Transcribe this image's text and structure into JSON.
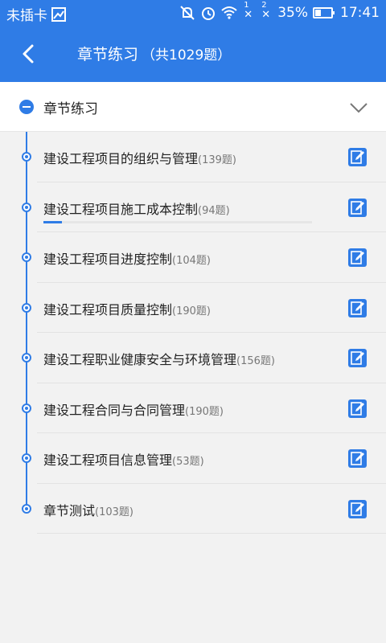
{
  "status_bar": {
    "carrier": "未插卡",
    "battery": "35%",
    "time": "17:41",
    "sim1": "1",
    "sim2": "2",
    "icons": [
      "image-icon",
      "mute-icon",
      "alarm-icon",
      "wifi-icon",
      "no-signal-icon",
      "no-signal-icon",
      "battery-icon"
    ]
  },
  "appbar": {
    "title": "章节练习",
    "subtitle": "（共1029题）"
  },
  "chapter": {
    "title": "章节练习"
  },
  "sections": [
    {
      "name": "建设工程项目的组织与管理",
      "count": "(139题)",
      "progress": null
    },
    {
      "name": "建设工程项目施工成本控制",
      "count": "(94题)",
      "progress": 0.07
    },
    {
      "name": "建设工程项目进度控制",
      "count": "(104题)",
      "progress": null
    },
    {
      "name": "建设工程项目质量控制",
      "count": "(190题)",
      "progress": null
    },
    {
      "name": "建设工程职业健康安全与环境管理",
      "count": "(156题)",
      "progress": null
    },
    {
      "name": "建设工程合同与合同管理",
      "count": "(190题)",
      "progress": null
    },
    {
      "name": "建设工程项目信息管理",
      "count": "(53题)",
      "progress": null
    },
    {
      "name": "章节测试",
      "count": "(103题)",
      "progress": null
    }
  ],
  "colors": {
    "accent": "#2f7ce6",
    "background": "#f2f2f2",
    "text": "#222222",
    "count_text": "#777777"
  }
}
